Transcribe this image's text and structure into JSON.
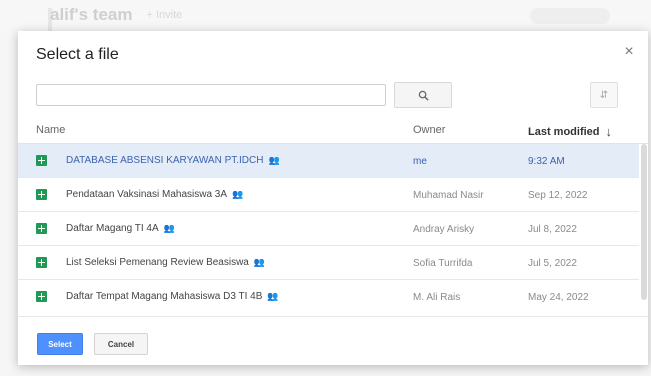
{
  "background": {
    "team_name": "alif's team",
    "invite_label": "+ Invite"
  },
  "dialog": {
    "title": "Select a file",
    "close_label": "×",
    "search": {
      "value": "",
      "placeholder": ""
    },
    "columns": {
      "name": "Name",
      "owner": "Owner",
      "last_modified": "Last modified",
      "sort_arrow": "↓"
    },
    "files": [
      {
        "name": "DATABASE ABSENSI KARYAWAN PT.IDCH",
        "owner": "me",
        "modified": "9:32 AM",
        "selected": true
      },
      {
        "name": "Pendataan Vaksinasi Mahasiswa 3A",
        "owner": "Muhamad Nasir",
        "modified": "Sep 12, 2022",
        "selected": false
      },
      {
        "name": "Daftar Magang TI 4A",
        "owner": "Andray Arisky",
        "modified": "Jul 8, 2022",
        "selected": false
      },
      {
        "name": "List Seleksi Pemenang Review Beasiswa",
        "owner": "Sofia Turrifda",
        "modified": "Jul 5, 2022",
        "selected": false
      },
      {
        "name": "Daftar Tempat Magang Mahasiswa D3 TI 4B",
        "owner": "M. Ali Rais",
        "modified": "May 24, 2022",
        "selected": false
      }
    ],
    "buttons": {
      "select": "Select",
      "cancel": "Cancel"
    },
    "icons": {
      "file": "sheets-icon",
      "shared": "shared-people-icon",
      "search": "search-icon",
      "sort": "sort-az-icon"
    },
    "colors": {
      "accent": "#4d90fe",
      "selected_row": "#e4ecf8",
      "sheets_green": "#1e9a55"
    }
  }
}
